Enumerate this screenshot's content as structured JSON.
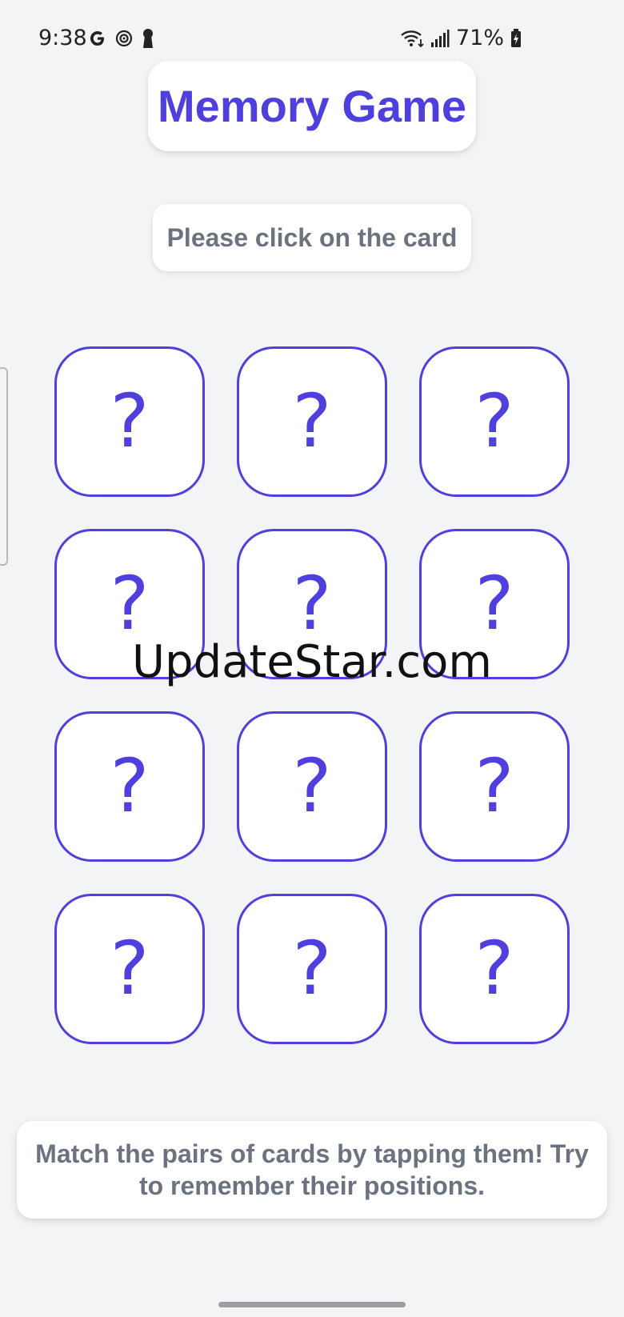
{
  "status_bar": {
    "time": "9:38",
    "battery": "71%",
    "left_icons": [
      "google-icon",
      "target-icon",
      "keyhole-icon"
    ],
    "right_icons": [
      "wifi-icon",
      "signal-icon",
      "battery-charging-icon"
    ]
  },
  "title": "Memory Game",
  "instruction": "Please click on the card",
  "cards": [
    "?",
    "?",
    "?",
    "?",
    "?",
    "?",
    "?",
    "?",
    "?",
    "?",
    "?",
    "?"
  ],
  "watermark": "UpdateStar.com",
  "hint": "Match the pairs of cards by tapping them! Try to remember their positions.",
  "colors": {
    "accent": "#4f3fdc",
    "muted_text": "#6b7280",
    "background": "#f3f4f6",
    "card_background": "#ffffff"
  }
}
